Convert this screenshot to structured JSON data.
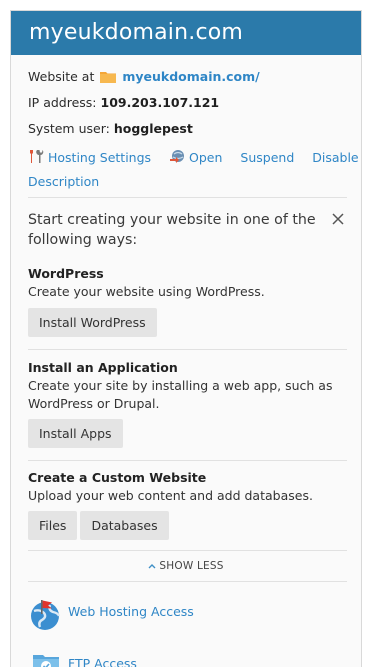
{
  "header": {
    "title": "myeukdomain.com"
  },
  "info": {
    "website_prefix": "Website at",
    "website_link": "myeukdomain.com/",
    "ip_label": "IP address:",
    "ip_value": "109.203.107.121",
    "user_label": "System user:",
    "user_value": "hogglepest"
  },
  "actions": {
    "hosting_settings": "Hosting Settings",
    "open": "Open",
    "suspend": "Suspend",
    "disable": "Disable",
    "description": "Description"
  },
  "start": {
    "heading": "Start creating your website in one of the following ways:"
  },
  "sections": {
    "wordpress": {
      "title": "WordPress",
      "text": "Create your website using WordPress.",
      "button": "Install WordPress"
    },
    "apps": {
      "title": "Install an Application",
      "text": "Create your site by installing a web app, such as WordPress or Drupal.",
      "button": "Install Apps"
    },
    "custom": {
      "title": "Create a Custom Website",
      "text": "Upload your web content and add databases.",
      "button_files": "Files",
      "button_databases": "Databases"
    }
  },
  "show_less": "SHOW LESS",
  "access": {
    "web_hosting": "Web Hosting Access",
    "ftp": "FTP Access"
  },
  "colors": {
    "header_bg": "#2b7aaa",
    "link": "#2f86c6",
    "button_bg": "#e4e4e4",
    "card_bg": "#fafafa"
  },
  "icons": [
    "folder-icon",
    "hosting-settings-icon",
    "open-icon",
    "close-icon",
    "chevron-up-icon",
    "globe-flag-icon",
    "ftp-folder-icon"
  ]
}
